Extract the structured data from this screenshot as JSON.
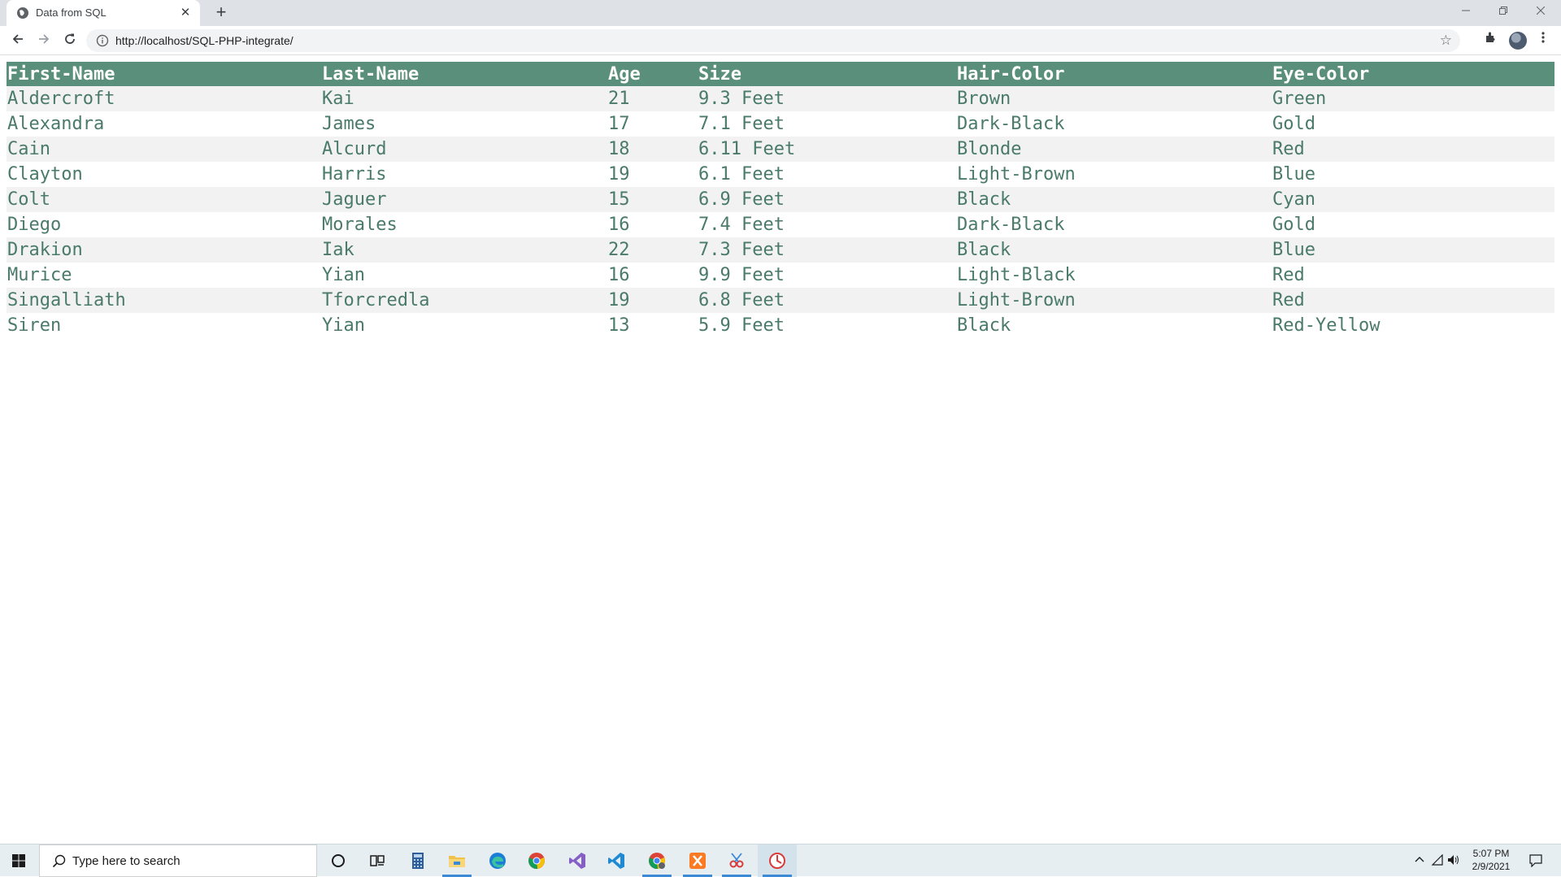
{
  "browser": {
    "tab_title": "Data from SQL",
    "tab_close": "✕",
    "new_tab": "+",
    "url": "http://localhost/SQL-PHP-integrate/"
  },
  "table": {
    "headers": [
      "First-Name",
      "Last-Name",
      "Age",
      "Size",
      "Hair-Color",
      "Eye-Color"
    ],
    "rows": [
      [
        "Aldercroft",
        "Kai",
        "21",
        "9.3 Feet",
        "Brown",
        "Green"
      ],
      [
        "Alexandra",
        "James",
        "17",
        "7.1 Feet",
        "Dark-Black",
        "Gold"
      ],
      [
        "Cain",
        "Alcurd",
        "18",
        "6.11 Feet",
        "Blonde",
        "Red"
      ],
      [
        "Clayton",
        "Harris",
        "19",
        "6.1 Feet",
        "Light-Brown",
        "Blue"
      ],
      [
        "Colt",
        "Jaguer",
        "15",
        "6.9 Feet",
        "Black",
        "Cyan"
      ],
      [
        "Diego",
        "Morales",
        "16",
        "7.4 Feet",
        "Dark-Black",
        "Gold"
      ],
      [
        "Drakion",
        "Iak",
        "22",
        "7.3 Feet",
        "Black",
        "Blue"
      ],
      [
        "Murice",
        "Yian",
        "16",
        "9.9 Feet",
        "Light-Black",
        "Red"
      ],
      [
        "Singalliath",
        "Tforcredla",
        "19",
        "6.8 Feet",
        "Light-Brown",
        "Red"
      ],
      [
        "Siren",
        "Yian",
        "13",
        "5.9 Feet",
        "Black",
        "Red-Yellow"
      ]
    ],
    "colors": {
      "header_bg": "#5a8f7b",
      "text": "#4a7a6a",
      "stripe": "#f2f2f2"
    }
  },
  "taskbar": {
    "search_placeholder": "Type here to search",
    "time": "5:07 PM",
    "date": "2/9/2021",
    "apps": [
      "cortana-icon",
      "task-view-icon",
      "calculator-icon",
      "file-explorer-icon",
      "edge-icon",
      "chrome-icon",
      "visual-studio-icon",
      "vscode-icon",
      "chrome-profile-icon",
      "xampp-icon",
      "snipping-tool-icon",
      "app-icon"
    ]
  }
}
